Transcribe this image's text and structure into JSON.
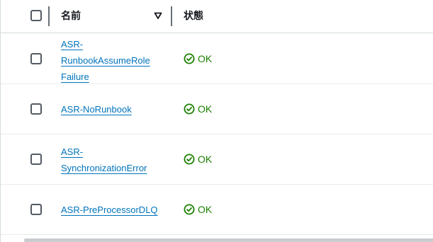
{
  "table": {
    "columns": {
      "name": "名前",
      "status": "状態"
    },
    "rows": [
      {
        "name": "ASR-\nRunbookAssumeRole\nFailure",
        "status": "OK"
      },
      {
        "name": "ASR-NoRunbook",
        "status": "OK"
      },
      {
        "name": "ASR-\nSynchronizationError",
        "status": "OK"
      },
      {
        "name": "ASR-PreProcessorDLQ",
        "status": "OK"
      }
    ]
  },
  "colors": {
    "link": "#0073bb",
    "status_ok": "#1d8102",
    "border": "#d5dbdb"
  },
  "icons": {
    "sort": "caret-down-icon",
    "status_ok": "check-circle-icon"
  }
}
